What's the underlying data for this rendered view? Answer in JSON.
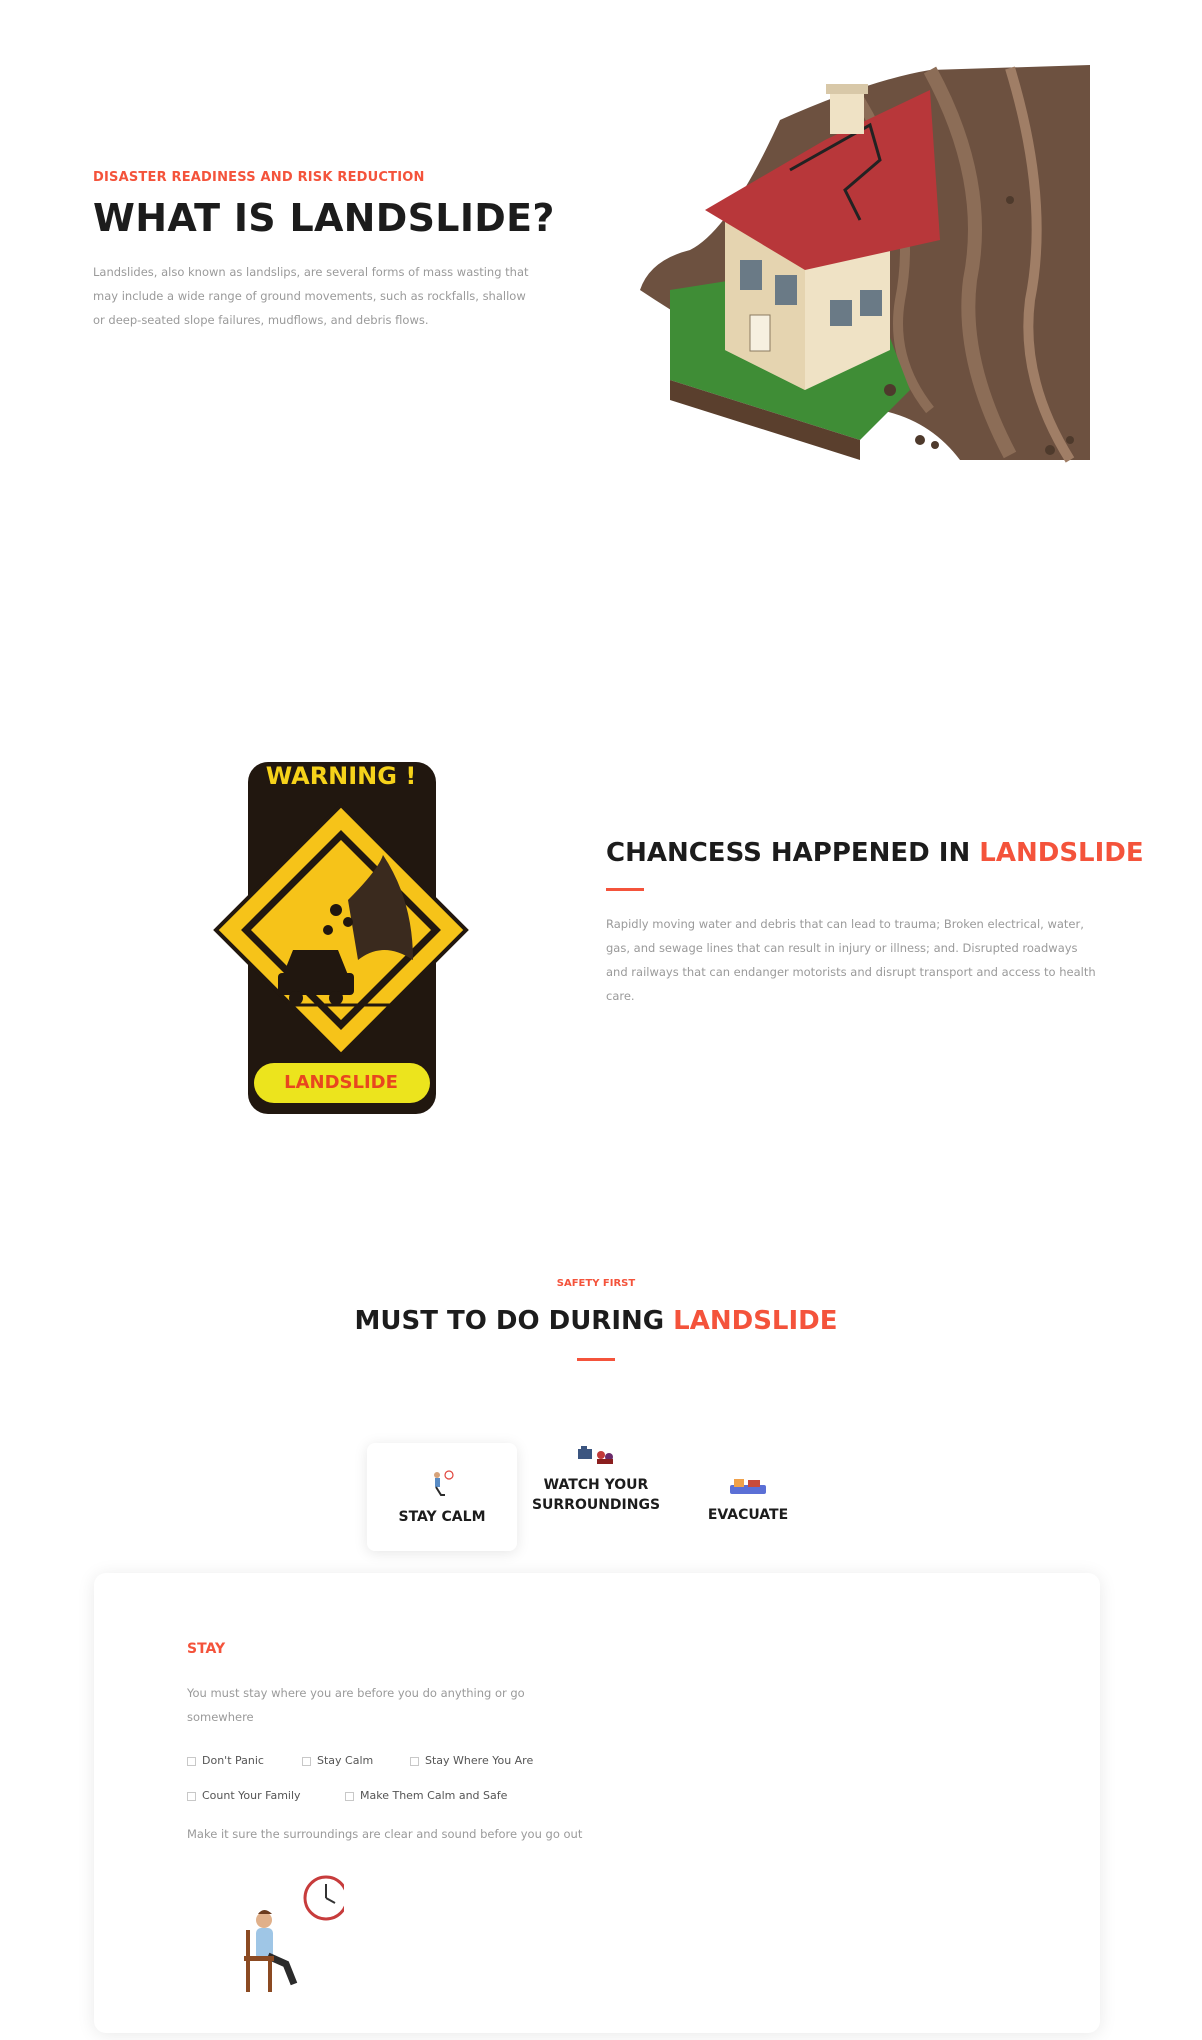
{
  "hero": {
    "eyebrow": "DISASTER READINESS AND RISK REDUCTION",
    "title": "WHAT IS LANDSLIDE?",
    "description": "Landslides, also known as landslips, are several forms of mass wasting that may include a wide range of ground movements, such as rockfalls, shallow or deep-seated slope failures, mudflows, and debris flows."
  },
  "warning_sign": {
    "top_text": "WARNING !",
    "bottom_text": "LANDSLIDE"
  },
  "chances": {
    "title_plain": "CHANCESS HAPPENED IN ",
    "title_accent": "LANDSLIDE",
    "description": "Rapidly moving water and debris that can lead to trauma; Broken electrical, water, gas, and sewage lines that can result in injury or illness; and. Disrupted roadways and railways that can endanger motorists and disrupt transport and access to health care."
  },
  "must_do": {
    "eyebrow": "SAFETY FIRST",
    "title_plain": "MUST TO DO DURING ",
    "title_accent": "LANDSLIDE"
  },
  "tabs": [
    {
      "label": "STAY CALM",
      "active": true
    },
    {
      "label_line1": "WATCH YOUR",
      "label_line2": "SURROUNDINGS",
      "active": false
    },
    {
      "label": "EVACUATE",
      "active": false
    }
  ],
  "panel": {
    "heading": "STAY",
    "intro": "You must stay where you are before you do anything or go somewhere",
    "checklist": [
      "Don't Panic",
      "Stay Calm",
      "Stay Where You Are",
      "Count Your Family",
      "Make Them Calm and Safe"
    ],
    "footer": "Make it sure the surroundings are clear and sound before you go out"
  },
  "colors": {
    "accent": "#f4533b",
    "sign_yellow": "#f6c319",
    "sign_dark": "#21170f"
  }
}
